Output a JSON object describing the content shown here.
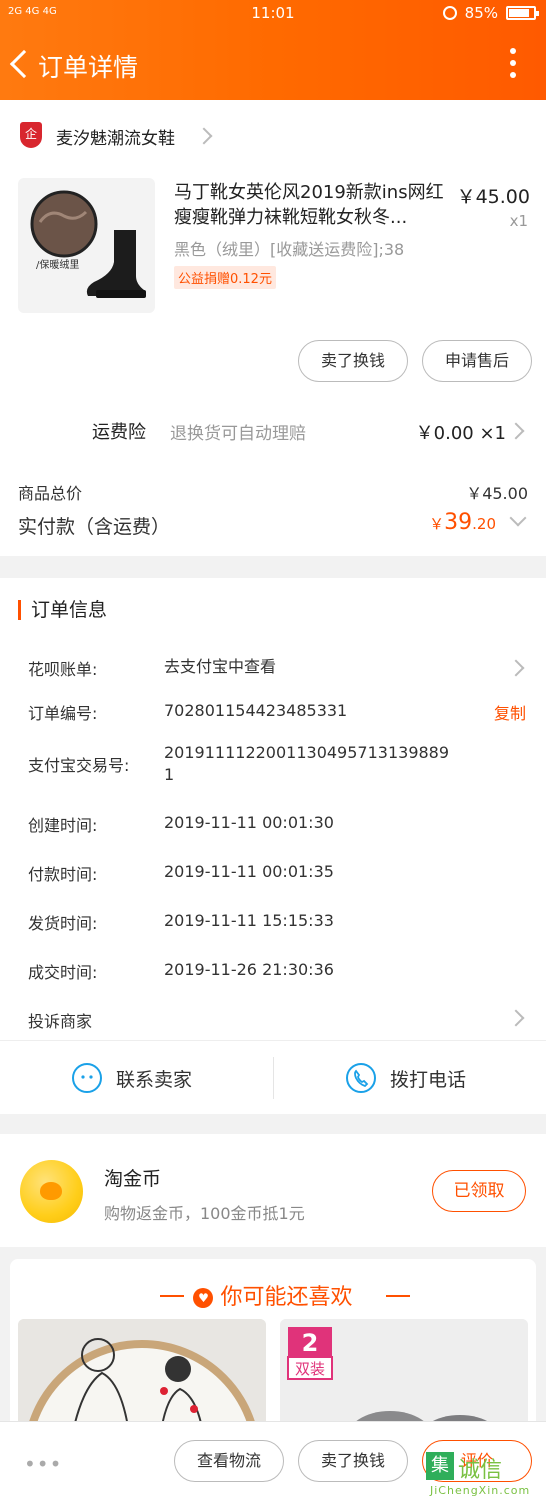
{
  "status": {
    "network": "2G 4G 4G",
    "time": "11:01",
    "battery": "85%"
  },
  "header": {
    "title": "订单详情"
  },
  "shop": {
    "name": "麦汐魅潮流女鞋",
    "badge": "企"
  },
  "product": {
    "title": "马丁靴女英伦风2019新款ins网红瘦瘦靴弹力袜靴短靴女秋冬...",
    "price": "￥45.00",
    "qty": "x1",
    "sku": "黑色（绒里）[收藏送运费险];38",
    "tag": "公益捐赠0.12元",
    "image_caption": "/保暖绒里"
  },
  "actions": {
    "exchange": "卖了换钱",
    "after_sale": "申请售后"
  },
  "insurance": {
    "label": "运费险",
    "desc": "退换货可自动理赔",
    "value": "￥0.00 ×1"
  },
  "totals": {
    "goods_label": "商品总价",
    "goods_value": "￥45.00",
    "paid_label": "实付款（含运费）",
    "paid_currency": "￥",
    "paid_int": "39",
    "paid_dec": ".20"
  },
  "order_info": {
    "title": "订单信息",
    "rows": [
      {
        "label": "花呗账单:",
        "value": "去支付宝中查看"
      },
      {
        "label": "订单编号:",
        "value": "702801154423485331"
      },
      {
        "label": "支付宝交易号:",
        "value": "20191111220011304957131398891"
      },
      {
        "label": "创建时间:",
        "value": "2019-11-11 00:01:30"
      },
      {
        "label": "付款时间:",
        "value": "2019-11-11 00:01:35"
      },
      {
        "label": "发货时间:",
        "value": "2019-11-11 15:15:33"
      },
      {
        "label": "成交时间:",
        "value": "2019-11-26 21:30:36"
      },
      {
        "label": "投诉商家",
        "value": ""
      }
    ],
    "copy_label": "复制"
  },
  "contact": {
    "seller": "联系卖家",
    "call": "拨打电话"
  },
  "coins": {
    "title": "淘金币",
    "desc": "购物返金币，100金币抵1元",
    "button": "已领取"
  },
  "recommend": {
    "title": "你可能还喜欢",
    "badge_num": "2",
    "badge_text": "双装"
  },
  "bottom": {
    "dots": "•••",
    "logistics": "查看物流",
    "sell": "卖了换钱",
    "review": "评价"
  },
  "watermark": {
    "box": "集",
    "text": "诚信",
    "url": "JiChengXin.com"
  },
  "colors": {
    "accent": "#ff5000",
    "header": "#ff6a00",
    "link_blue": "#1aa1e8"
  }
}
